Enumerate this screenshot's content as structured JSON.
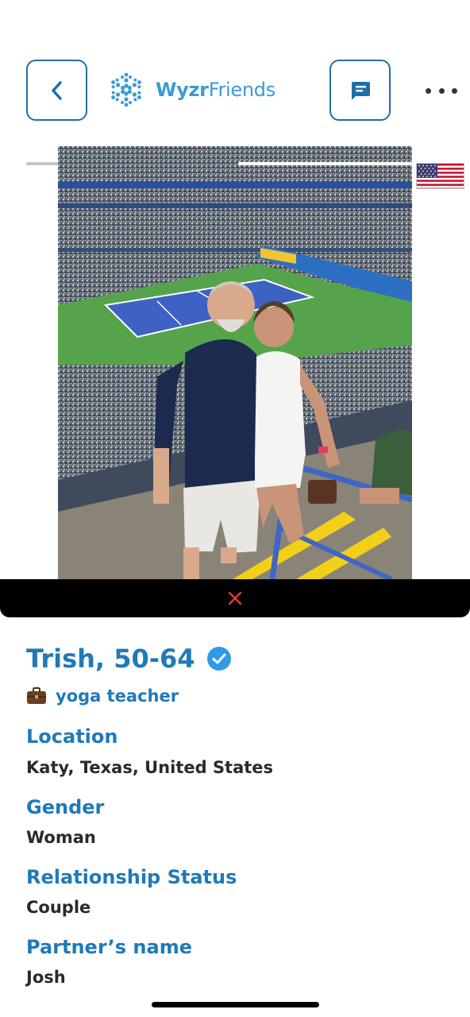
{
  "header": {
    "logo_word1": "Wyzr",
    "logo_word2": "Friends",
    "back_icon": "chevron-left-icon",
    "message_icon": "message-icon",
    "more_icon": "more-horizontal-icon"
  },
  "photo": {
    "country_flag": "us-flag-icon",
    "close_icon": "close-icon"
  },
  "profile": {
    "name_age": "Trish, 50-64",
    "verified_icon": "verified-check-icon",
    "job_icon": "briefcase-icon",
    "occupation": "yoga teacher",
    "location_label": "Location",
    "location_value": "Katy, Texas, United States",
    "gender_label": "Gender",
    "gender_value": "Woman",
    "relationship_label": "Relationship Status",
    "relationship_value": "Couple",
    "partner_label": "Partner’s name",
    "partner_value": "Josh"
  },
  "colors": {
    "accent": "#1f7ab8",
    "logo": "#3a9bd5",
    "close_x": "#e53935"
  }
}
